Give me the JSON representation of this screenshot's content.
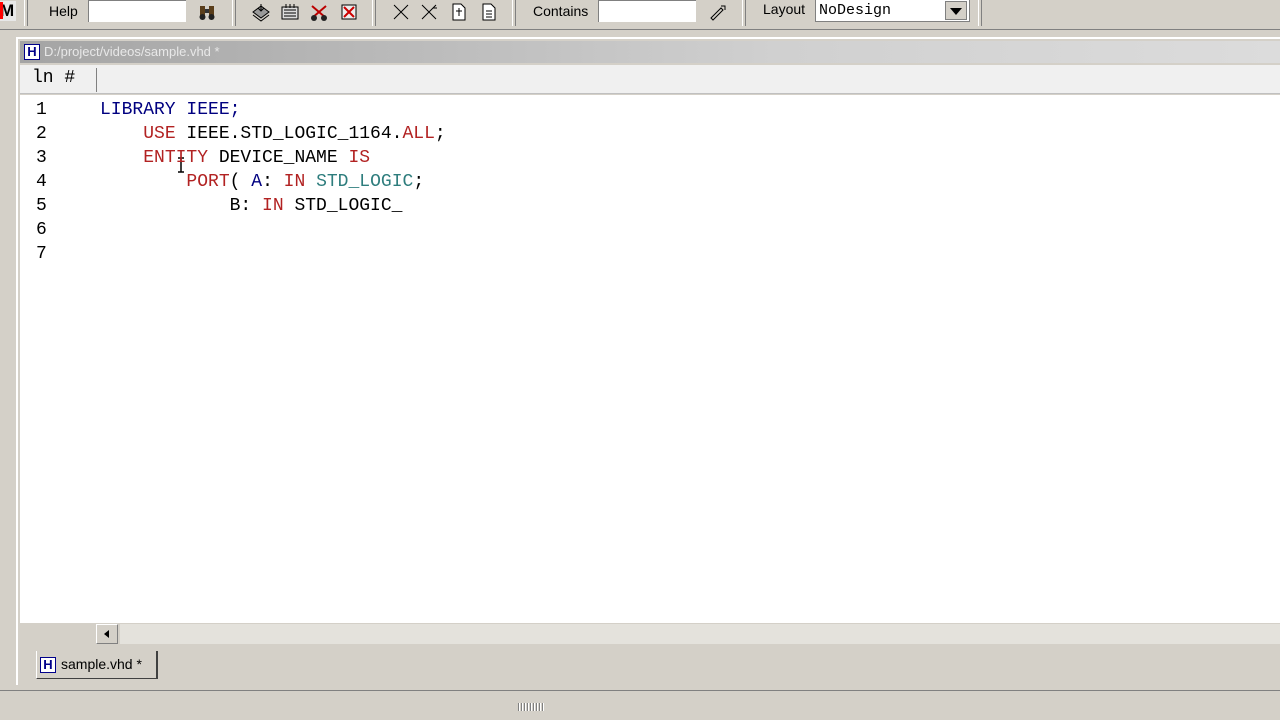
{
  "toolbar": {
    "help_label": "Help",
    "contains_label": "Contains",
    "layout_label": "Layout",
    "layout_value": "NoDesign",
    "logo_letter": "M",
    "icons": [
      "binoculars-icon",
      "compile-icon",
      "compile-all-icon",
      "simulate-icon",
      "break-icon",
      "wave-icon",
      "wave-zoom-icon",
      "new-file-icon",
      "save-file-icon",
      "pen-icon",
      "chevron-down-icon"
    ]
  },
  "document": {
    "title": "D:/project/videos/sample.vhd *",
    "file_icon_letter": "H",
    "gutter_label": "ln #",
    "lines": [
      {
        "n": "1",
        "tokens": [
          {
            "t": "LIBRARY ",
            "c": "id"
          },
          {
            "t": "IEEE;",
            "c": "id"
          }
        ]
      },
      {
        "n": "2",
        "tokens": [
          {
            "t": "    ",
            "c": "pu"
          },
          {
            "t": "USE",
            "c": "kw"
          },
          {
            "t": " IEEE.STD_LOGIC_1164.",
            "c": "pu"
          },
          {
            "t": "ALL",
            "c": "kw"
          },
          {
            "t": ";",
            "c": "pu"
          }
        ]
      },
      {
        "n": "3",
        "tokens": [
          {
            "t": "    ",
            "c": "pu"
          },
          {
            "t": "ENTITY",
            "c": "kw"
          },
          {
            "t": " DEVICE_NAME ",
            "c": "pu"
          },
          {
            "t": "IS",
            "c": "kw"
          }
        ]
      },
      {
        "n": "4",
        "tokens": [
          {
            "t": "        ",
            "c": "pu"
          },
          {
            "t": "PORT",
            "c": "kw"
          },
          {
            "t": "( ",
            "c": "pu"
          },
          {
            "t": "A",
            "c": "id"
          },
          {
            "t": ": ",
            "c": "pu"
          },
          {
            "t": "IN",
            "c": "kw"
          },
          {
            "t": " STD_LOGIC",
            "c": "ty"
          },
          {
            "t": ";",
            "c": "pu"
          }
        ]
      },
      {
        "n": "5",
        "tokens": [
          {
            "t": "            B: ",
            "c": "pu"
          },
          {
            "t": "IN",
            "c": "kw"
          },
          {
            "t": " STD_LOGIC_",
            "c": "pu"
          }
        ]
      },
      {
        "n": "6",
        "tokens": []
      },
      {
        "n": "7",
        "tokens": []
      }
    ]
  },
  "tab": {
    "label": "sample.vhd *",
    "icon_letter": "H"
  },
  "colors": {
    "keyword": "#b22222",
    "identifier": "#000080",
    "type": "#2e7d7d",
    "chrome": "#d4d0c8"
  }
}
